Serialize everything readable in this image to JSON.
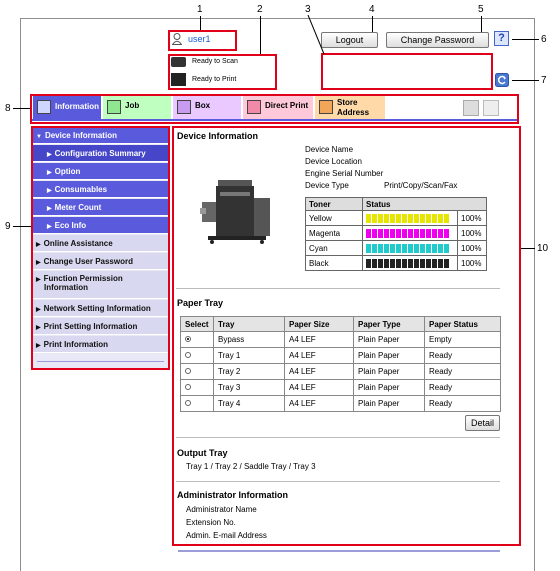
{
  "callouts": [
    "1",
    "2",
    "3",
    "4",
    "5",
    "6",
    "7",
    "8",
    "9",
    "10"
  ],
  "header": {
    "user": "user1",
    "status_scan": "Ready to Scan",
    "status_print": "Ready to Print",
    "logout": "Logout",
    "change_password": "Change Password",
    "help": "?"
  },
  "tabs": [
    {
      "label": "Information",
      "icon": "information-icon"
    },
    {
      "label": "Job",
      "icon": "job-icon"
    },
    {
      "label": "Box",
      "icon": "box-icon"
    },
    {
      "label": "Direct Print",
      "icon": "direct-print-icon"
    },
    {
      "label": "Store",
      "label2": "Address",
      "icon": "store-address-icon"
    }
  ],
  "sidebar": {
    "items": [
      {
        "label": "Device Information"
      },
      {
        "label": "Configuration Summary"
      },
      {
        "label": "Option"
      },
      {
        "label": "Consumables"
      },
      {
        "label": "Meter Count"
      },
      {
        "label": "Eco Info"
      },
      {
        "label": "Online Assistance"
      },
      {
        "label": "Change User Password"
      },
      {
        "label": "Function Permission",
        "label2": "Information"
      },
      {
        "label": "Network Setting Information"
      },
      {
        "label": "Print Setting Information"
      },
      {
        "label": "Print Information"
      }
    ]
  },
  "device": {
    "title": "Device Information",
    "name_label": "Device Name",
    "location_label": "Device Location",
    "serial_label": "Engine Serial Number",
    "type_label": "Device Type",
    "type_value": "Print/Copy/Scan/Fax"
  },
  "toner": {
    "headers": [
      "Toner",
      "Status"
    ],
    "rows": [
      {
        "name": "Yellow",
        "pct": "100%",
        "color": "#e6e600",
        "level": 1.0
      },
      {
        "name": "Magenta",
        "pct": "100%",
        "color": "#ee00ee",
        "level": 1.0
      },
      {
        "name": "Cyan",
        "pct": "100%",
        "color": "#22cccc",
        "level": 1.0
      },
      {
        "name": "Black",
        "pct": "100%",
        "color": "#222222",
        "level": 1.0
      }
    ]
  },
  "paper": {
    "title": "Paper Tray",
    "headers": [
      "Select",
      "Tray",
      "Paper Size",
      "Paper Type",
      "Paper Status"
    ],
    "rows": [
      {
        "tray": "Bypass",
        "size": "A4 LEF",
        "type": "Plain Paper",
        "status": "Empty"
      },
      {
        "tray": "Tray 1",
        "size": "A4 LEF",
        "type": "Plain Paper",
        "status": "Ready"
      },
      {
        "tray": "Tray 2",
        "size": "A4 LEF",
        "type": "Plain Paper",
        "status": "Ready"
      },
      {
        "tray": "Tray 3",
        "size": "A4 LEF",
        "type": "Plain Paper",
        "status": "Ready"
      },
      {
        "tray": "Tray 4",
        "size": "A4 LEF",
        "type": "Plain Paper",
        "status": "Ready"
      }
    ],
    "detail": "Detail"
  },
  "output": {
    "title": "Output Tray",
    "value": "Tray 1 / Tray 2 / Saddle Tray / Tray 3"
  },
  "admin": {
    "title": "Administrator Information",
    "name": "Administrator Name",
    "ext": "Extension No.",
    "email": "Admin. E-mail Address"
  },
  "colors": {
    "callout_red": "#e0001a",
    "nav_blue": "#5a5adc"
  }
}
